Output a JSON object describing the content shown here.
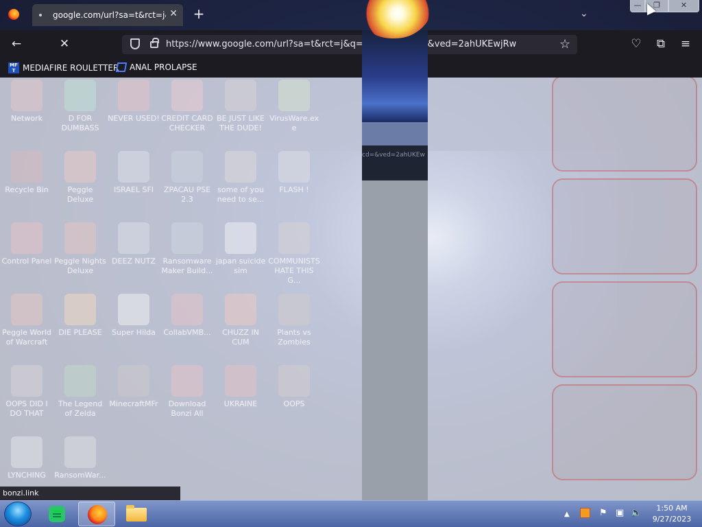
{
  "browser": {
    "tab_title": "google.com/url?sa=t&rct=j&q=",
    "url": "https://www.google.com/url?sa=t&rct=j&q=&e...web&cd=&ved=2ahUKEwjRw",
    "overlay_url_fragment": "cd=&ved=2ahUKEw",
    "status_link": "bonzi.link",
    "bookmarks": [
      "MEDIAFIRE ROULETTER",
      "ANAL PROLAPSE"
    ]
  },
  "desktop": {
    "icons": [
      {
        "label": "Network",
        "color": "#c0392b"
      },
      {
        "label": "D FOR DUMBASS",
        "color": "#27ae60"
      },
      {
        "label": "NEVER USED!",
        "color": "#c62828"
      },
      {
        "label": "CREDIT CARD CHECKER",
        "color": "#e05050"
      },
      {
        "label": "BE JUST LIKE THE DUDE!",
        "color": "#8d6e63"
      },
      {
        "label": "VirusWare.exe",
        "color": "#7cb342"
      },
      {
        "label": "Recycle Bin",
        "color": "#8b0000"
      },
      {
        "label": "Peggle Deluxe",
        "color": "#d84315"
      },
      {
        "label": "ISRAEL SFI",
        "color": "#90a4ae"
      },
      {
        "label": "ZPACAU PSE 2.3",
        "color": "#546e7a"
      },
      {
        "label": "some of you need to se...",
        "color": "#a1887f"
      },
      {
        "label": "FLASH !",
        "color": "#9e9e9e"
      },
      {
        "label": "Control Panel",
        "color": "#c62828"
      },
      {
        "label": "Peggle Nights Deluxe",
        "color": "#bf360c"
      },
      {
        "label": "DEEZ NUTZ",
        "color": "#90a4ae"
      },
      {
        "label": "Ransomware Maker Build...",
        "color": "#607d8b"
      },
      {
        "label": "japan suicide sim",
        "color": "#eeeeee"
      },
      {
        "label": "COMMUNISTS HATE THIS G...",
        "color": "#8d6e63"
      },
      {
        "label": "Peggle World of Warcraft",
        "color": "#bf360c"
      },
      {
        "label": "DIE PLEASE",
        "color": "#ff8f00"
      },
      {
        "label": "Super Hilda",
        "color": "#f5f5dc"
      },
      {
        "label": "CollabVMB...",
        "color": "#c62828"
      },
      {
        "label": "CHUZZ IN CUM",
        "color": "#e64a19"
      },
      {
        "label": "Plants vs Zombies",
        "color": "#6d4c41"
      },
      {
        "label": "OOPS DID I DO THAT",
        "color": "#8d6e63"
      },
      {
        "label": "The Legend of Zelda",
        "color": "#2e7d32"
      },
      {
        "label": "MinecraftMFr",
        "color": "#5d4037"
      },
      {
        "label": "Download Bonzi All",
        "color": "#c62828"
      },
      {
        "label": "UKRAINE",
        "color": "#b71c1c"
      },
      {
        "label": "OOPS",
        "color": "#795548"
      },
      {
        "label": "LYNCHING",
        "color": "#bdbdbd"
      },
      {
        "label": "RansomWar...",
        "color": "#9e9e9e"
      }
    ]
  },
  "taskbar": {
    "time": "1:50 AM",
    "date": "9/27/2023"
  }
}
